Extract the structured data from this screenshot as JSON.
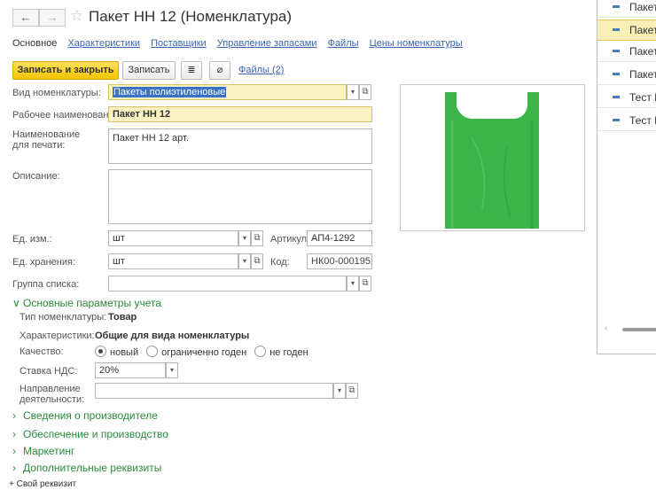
{
  "right_list": {
    "items": [
      "Пакет",
      "Пакет",
      "Пакет",
      "Пакет",
      "Тест М",
      "Тест М"
    ],
    "selected_index": 1
  },
  "header": {
    "back_icon": "arrow-left-icon",
    "forward_icon": "arrow-right-icon",
    "favorite_icon": "star-icon",
    "title": "Пакет НН 12 (Номенклатура)"
  },
  "tabs": [
    "Основное",
    "Характеристики",
    "Поставщики",
    "Управление запасами",
    "Файлы",
    "Цены номенклатуры"
  ],
  "toolbar": {
    "save_close": "Записать и закрыть",
    "save": "Записать",
    "files": "Файлы (2)"
  },
  "fields": {
    "vid_label": "Вид номенклатуры:",
    "vid_value": "Пакеты полиэтиленовые",
    "work_name_label": "Рабочее наименование:",
    "work_name_value": "Пакет НН 12",
    "print_name_label_1": "Наименование",
    "print_name_label_2": "для печати:",
    "print_name_value": "Пакет НН 12 арт.",
    "desc_label": "Описание:",
    "desc_value": "",
    "unit_label": "Ед. изм.:",
    "unit_value": "шт",
    "article_label": "Артикул:",
    "article_value": "АП4-1292",
    "storage_unit_label": "Ед. хранения:",
    "storage_unit_value": "шт",
    "code_label": "Код:",
    "code_value": "НК00-0001952",
    "group_label": "Группа списка:",
    "group_value": ""
  },
  "main_params": {
    "header": "Основные параметры учета",
    "type_label": "Тип номенклатуры:",
    "type_value": "Товар",
    "char_label": "Характеристики:",
    "char_value": "Общие для вида номенклатуры",
    "quality_label": "Качество:",
    "quality_options": [
      "новый",
      "ограниченно годен",
      "не годен"
    ],
    "quality_selected": 0,
    "vat_label": "Ставка НДС:",
    "vat_value": "20%",
    "direction_label_1": "Направление",
    "direction_label_2": "деятельности:",
    "direction_value": ""
  },
  "sections": [
    "Сведения о производителе",
    "Обеспечение и производство",
    "Маркетинг",
    "Дополнительные реквизиты"
  ],
  "add_requisite": "+ Свой реквизит",
  "colors": {
    "accent_yellow": "#f5c400",
    "link_blue": "#3a66b0",
    "section_green": "#2a8a3a",
    "bag_green": "#3bb54a"
  }
}
